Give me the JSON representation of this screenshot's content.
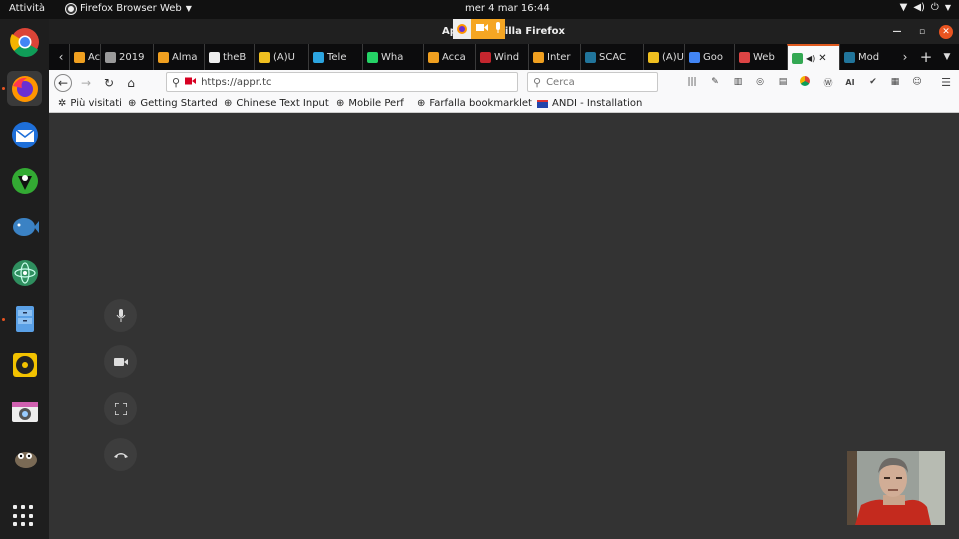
{
  "topbar": {
    "activities": "Attività",
    "app_name": "Firefox Browser Web",
    "clock": "mer 4 mar  16:44"
  },
  "window": {
    "title_left": "Ap",
    "title_right": "zilla Firefox"
  },
  "tabs": [
    {
      "label": "Acca",
      "color": "#f0a020"
    },
    {
      "label": "2019",
      "color": "#9a9a9a"
    },
    {
      "label": "Alma",
      "color": "#f0a020"
    },
    {
      "label": "theB",
      "color": "#eeeeee"
    },
    {
      "label": "(A)U",
      "color": "#f0c020"
    },
    {
      "label": "Tele",
      "color": "#2ca5e0"
    },
    {
      "label": "Wha",
      "color": "#25d366"
    },
    {
      "label": "Acca",
      "color": "#f0a020"
    },
    {
      "label": "Wind",
      "color": "#c4262e"
    },
    {
      "label": "Inter",
      "color": "#f0a020"
    },
    {
      "label": "SCAC",
      "color": "#21759b"
    },
    {
      "label": "(A)U",
      "color": "#f0c020"
    },
    {
      "label": "Goo",
      "color": "#4285f4"
    },
    {
      "label": "Web",
      "color": "#d44"
    },
    {
      "label": "",
      "color": "#34a853"
    },
    {
      "label": "Mod",
      "color": "#21759b"
    }
  ],
  "navbar": {
    "url": "https://appr.tc",
    "search_placeholder": "Cerca"
  },
  "bookmarks": [
    {
      "label": "Più visitati"
    },
    {
      "label": "Getting Started"
    },
    {
      "label": "Chinese Text Input"
    },
    {
      "label": "Mobile Perf"
    },
    {
      "label": "Farfalla bookmarklet"
    },
    {
      "label": "ANDI - Installation"
    }
  ],
  "call_controls": [
    "microphone-icon",
    "camera-icon",
    "fullscreen-icon",
    "hangup-icon"
  ],
  "colors": {
    "accent": "#e05a1f",
    "content_bg": "#333333",
    "indicator": "#f5a623"
  }
}
